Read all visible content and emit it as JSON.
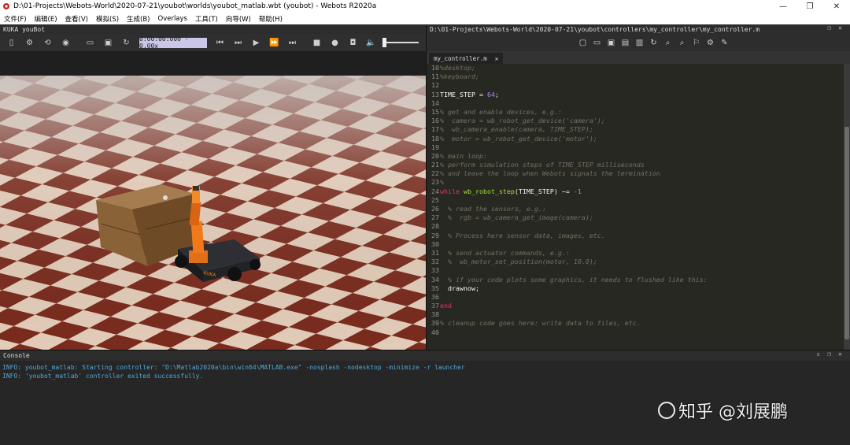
{
  "window": {
    "title": "D:\\01-Projects\\Webots-World\\2020-07-21\\youbot\\worlds\\youbot_matlab.wbt (youbot) - Webots R2020a",
    "minimize": "—",
    "maximize": "❐",
    "close": "✕"
  },
  "menu": [
    "文件(F)",
    "编辑(E)",
    "查看(V)",
    "模拟(S)",
    "生成(B)",
    "Overlays",
    "工具(T)",
    "向导(W)",
    "帮助(H)"
  ],
  "scene_panel": {
    "title": "KUKA youBot",
    "time": "0:00:00:000 - 0.00x"
  },
  "editor_panel": {
    "path": "D:\\01-Projects\\Webots-World\\2020-07-21\\youbot\\controllers\\my_controller\\my_controller.m",
    "tab": "my_controller.m",
    "tab_close": "✕",
    "lines": [
      {
        "n": "10",
        "t": "%desktop;",
        "k": "comment"
      },
      {
        "n": "11",
        "t": "%keyboard;",
        "k": "comment"
      },
      {
        "n": "12",
        "t": "",
        "k": "plain"
      },
      {
        "n": "13",
        "t": "TIME_STEP = 64;",
        "k": "assign"
      },
      {
        "n": "14",
        "t": "",
        "k": "plain"
      },
      {
        "n": "15",
        "t": "% get and enable devices, e.g.:",
        "k": "comment"
      },
      {
        "n": "16",
        "t": "%  camera = wb_robot_get_device('camera');",
        "k": "comment"
      },
      {
        "n": "17",
        "t": "%  wb_camera_enable(camera, TIME_STEP);",
        "k": "comment"
      },
      {
        "n": "18",
        "t": "%  motor = wb_robot_get_device('motor');",
        "k": "comment"
      },
      {
        "n": "19",
        "t": "",
        "k": "plain"
      },
      {
        "n": "20",
        "t": "% main loop:",
        "k": "comment"
      },
      {
        "n": "21",
        "t": "% perform simulation steps of TIME_STEP milliseconds",
        "k": "comment"
      },
      {
        "n": "22",
        "t": "% and leave the loop when Webots signals the termination",
        "k": "comment"
      },
      {
        "n": "23",
        "t": "%",
        "k": "comment"
      },
      {
        "n": "24",
        "t": "while wb_robot_step(TIME_STEP) ~= -1",
        "k": "while"
      },
      {
        "n": "25",
        "t": "",
        "k": "plain"
      },
      {
        "n": "26",
        "t": "  % read the sensors, e.g.:",
        "k": "comment"
      },
      {
        "n": "27",
        "t": "  %  rgb = wb_camera_get_image(camera);",
        "k": "comment"
      },
      {
        "n": "28",
        "t": "",
        "k": "plain"
      },
      {
        "n": "29",
        "t": "  % Process here sensor data, images, etc.",
        "k": "comment"
      },
      {
        "n": "30",
        "t": "",
        "k": "plain"
      },
      {
        "n": "31",
        "t": "  % send actuator commands, e.g.:",
        "k": "comment"
      },
      {
        "n": "32",
        "t": "  %  wb_motor_set_position(motor, 10.0);",
        "k": "comment"
      },
      {
        "n": "33",
        "t": "",
        "k": "plain"
      },
      {
        "n": "34",
        "t": "  % if your code plots some graphics, it needs to flushed like this:",
        "k": "comment"
      },
      {
        "n": "35",
        "t": "  drawnow;",
        "k": "plain"
      },
      {
        "n": "36",
        "t": "",
        "k": "plain"
      },
      {
        "n": "37",
        "t": "end",
        "k": "kw"
      },
      {
        "n": "38",
        "t": "",
        "k": "plain"
      },
      {
        "n": "39",
        "t": "% cleanup code goes here: write data to files, etc.",
        "k": "comment"
      },
      {
        "n": "40",
        "t": "",
        "k": "plain"
      }
    ]
  },
  "console": {
    "title": "Console",
    "lines": [
      "INFO: youbot_matlab: Starting controller: \"D:\\Matlab2020a\\bin\\win64\\MATLAB.exe\" -nosplash -nodesktop -minimize -r launcher",
      "INFO: 'youbot_matlab' controller exited successfully."
    ]
  },
  "robot_label": "KUKA",
  "watermark": "知乎 @刘展鹏",
  "colors": {
    "checker_dark": "#7a2a1c",
    "checker_light": "#e9d2bf",
    "robot_orange": "#f07a1a",
    "crate": "#8a6238",
    "console_text": "#52a8d8",
    "editor_bg": "#272822"
  }
}
